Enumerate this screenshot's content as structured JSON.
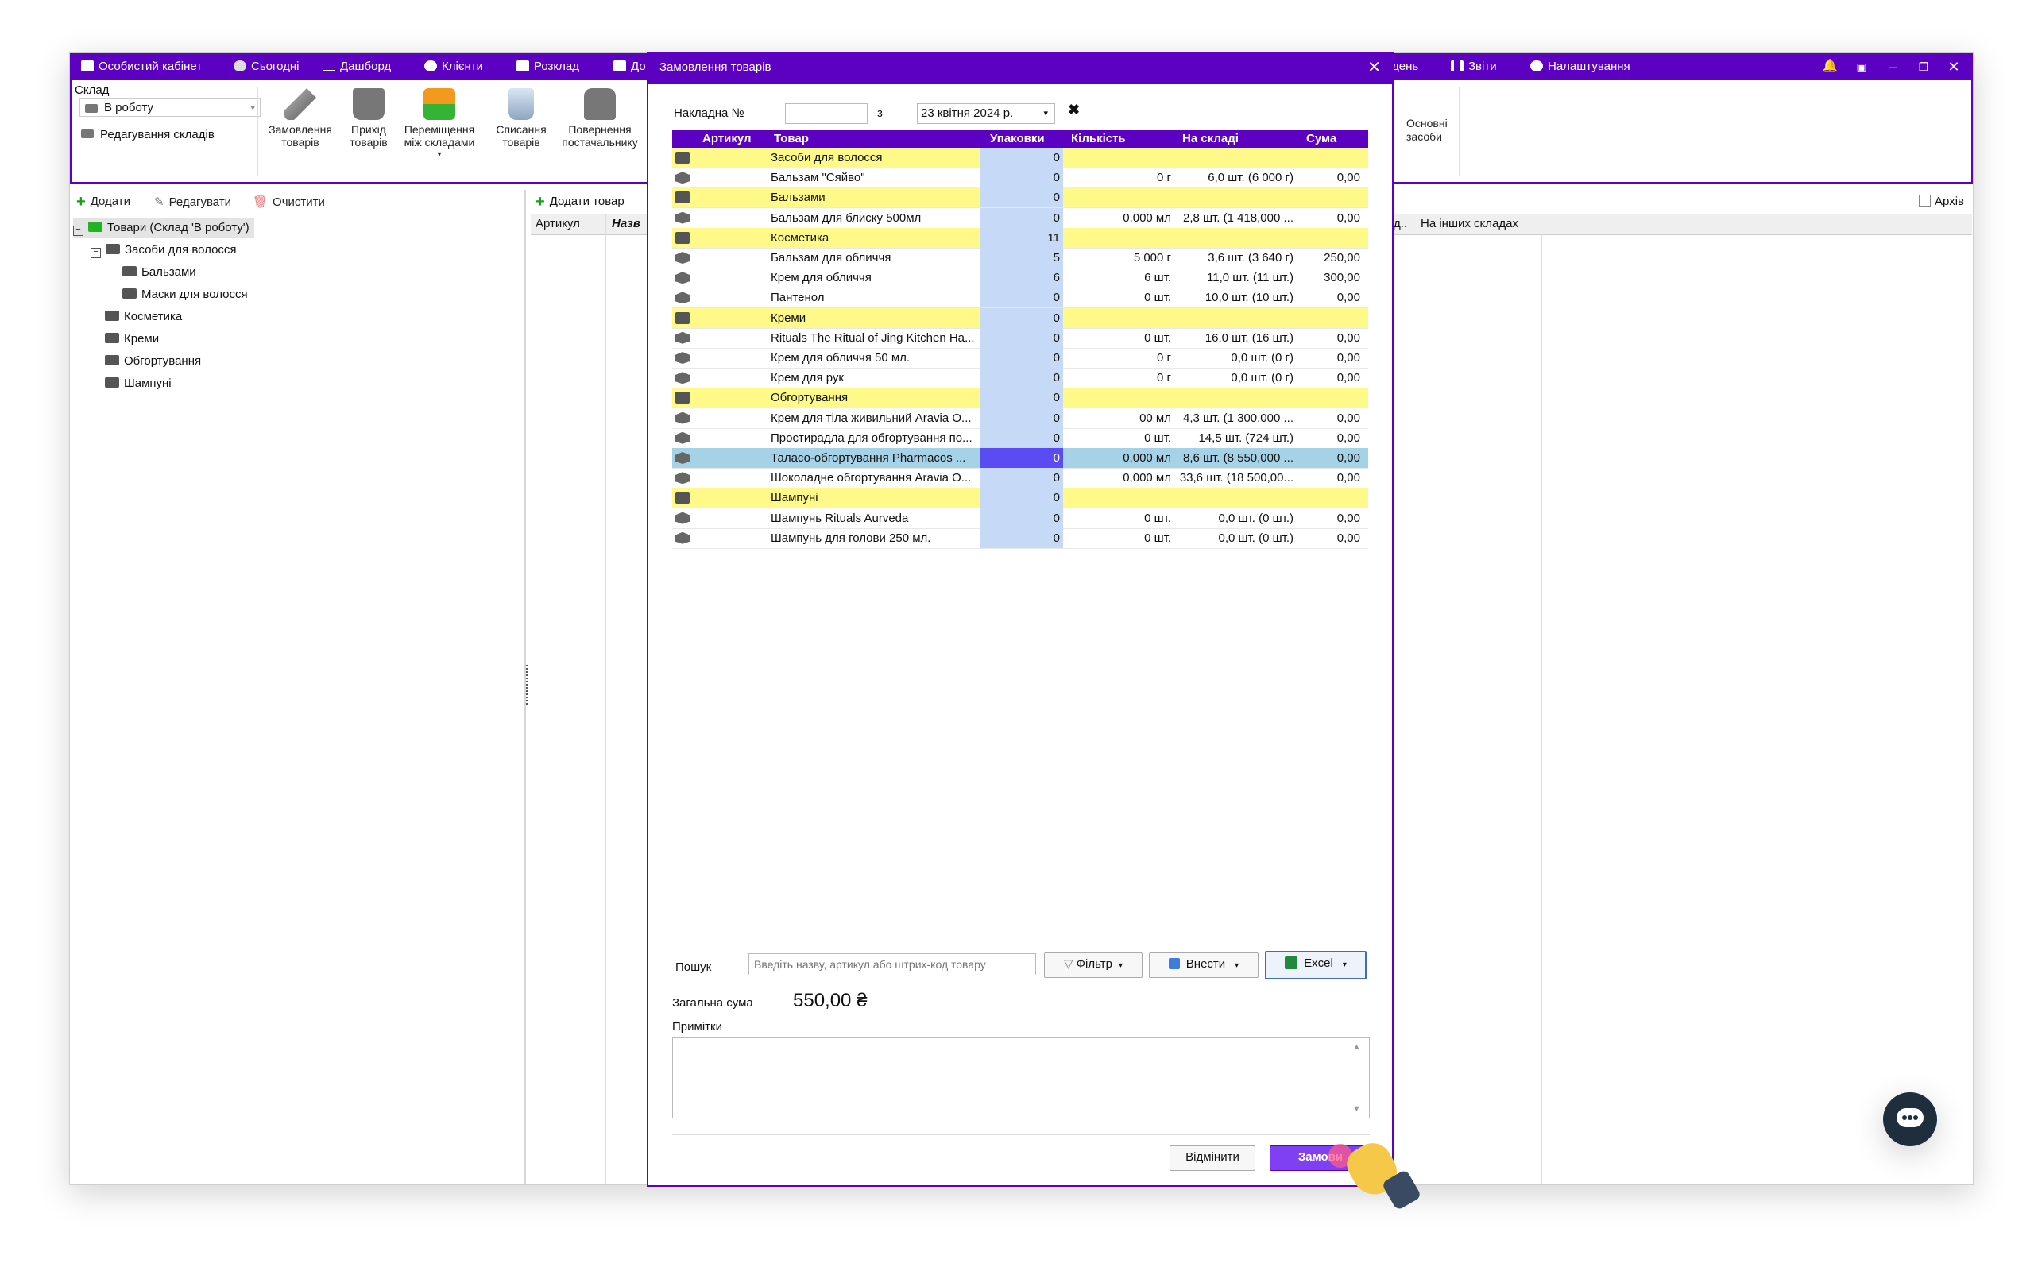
{
  "topbar": {
    "items": [
      "Особистий кабінет",
      "Сьогодні",
      "Дашборд",
      "Клієнти",
      "Розклад",
      "До",
      "день",
      "Звіти",
      "Налаштування"
    ]
  },
  "ribbon": {
    "warehouse_label": "Склад",
    "warehouse_value": "В роботу",
    "edit_warehouses": "Редагування складів",
    "buttons": [
      {
        "label1": "Замовлення",
        "label2": "товарів"
      },
      {
        "label1": "Прихід",
        "label2": "товарів"
      },
      {
        "label1": "Переміщення",
        "label2": "між складами"
      },
      {
        "label1": "Списання",
        "label2": "товарів"
      },
      {
        "label1": "Повернення",
        "label2": "постачальнику"
      }
    ],
    "assets_1": "Основні",
    "assets_2": "засоби"
  },
  "left_toolbar": {
    "add": "Додати",
    "edit": "Редагувати",
    "clear": "Очистити"
  },
  "tree": {
    "root": "Товари (Склад 'В роботу')",
    "items": [
      "Засоби для волосся",
      "Бальзами",
      "Маски для волосся",
      "Косметика",
      "Креми",
      "Обгортування",
      "Шампуні"
    ]
  },
  "middle": {
    "add_product": "Додати товар",
    "col_article": "Артикул",
    "col_name": "Назв"
  },
  "right": {
    "archive": "Архів",
    "col_other": "На інших складах",
    "col_partial": "д.."
  },
  "dialog": {
    "title": "Замовлення товарів",
    "invoice_label": "Накладна  №",
    "from_label": "з",
    "date_value": "23 квітня 2024 р.",
    "columns": [
      "Артикул",
      "Товар",
      "Упаковки",
      "Кількість",
      "На складі",
      "Сума"
    ],
    "rows": [
      {
        "type": "folder",
        "name": "Засоби для волосся",
        "packs": "0",
        "qty": "",
        "stock": "",
        "sum": ""
      },
      {
        "type": "item",
        "name": "Бальзам \"Сяйво\"",
        "packs": "0",
        "qty": "0 г",
        "stock": "6,0 шт. (6 000 г)",
        "sum": "0,00"
      },
      {
        "type": "folder",
        "name": "Бальзами",
        "packs": "0",
        "qty": "",
        "stock": "",
        "sum": ""
      },
      {
        "type": "item",
        "name": "Бальзам для блиску 500мл",
        "packs": "0",
        "qty": "0,000 мл",
        "stock": "2,8 шт. (1 418,000 ...",
        "sum": "0,00"
      },
      {
        "type": "folder",
        "name": "Косметика",
        "packs": "11",
        "qty": "",
        "stock": "",
        "sum": ""
      },
      {
        "type": "item",
        "name": "Бальзам для обличчя",
        "packs": "5",
        "qty": "5 000 г",
        "stock": "3,6 шт. (3 640 г)",
        "sum": "250,00"
      },
      {
        "type": "item",
        "name": "Крем для обличчя",
        "packs": "6",
        "qty": "6 шт.",
        "stock": "11,0 шт. (11 шт.)",
        "sum": "300,00"
      },
      {
        "type": "item",
        "name": "Пантенол",
        "packs": "0",
        "qty": "0 шт.",
        "stock": "10,0 шт. (10 шт.)",
        "sum": "0,00"
      },
      {
        "type": "folder",
        "name": "Креми",
        "packs": "0",
        "qty": "",
        "stock": "",
        "sum": ""
      },
      {
        "type": "item",
        "name": "Rituals The Ritual of Jing Kitchen Ha...",
        "packs": "0",
        "qty": "0 шт.",
        "stock": "16,0 шт. (16 шт.)",
        "sum": "0,00"
      },
      {
        "type": "item",
        "name": "Крем для обличчя 50 мл.",
        "packs": "0",
        "qty": "0 г",
        "stock": "0,0 шт. (0 г)",
        "sum": "0,00"
      },
      {
        "type": "item",
        "name": "Крем для рук",
        "packs": "0",
        "qty": "0 г",
        "stock": "0,0 шт. (0 г)",
        "sum": "0,00"
      },
      {
        "type": "folder",
        "name": "Обгортування",
        "packs": "0",
        "qty": "",
        "stock": "",
        "sum": ""
      },
      {
        "type": "item",
        "name": "Крем для тіла живильний Aravia O...",
        "packs": "0",
        "qty": "00 мл",
        "stock": "4,3 шт. (1 300,000 ...",
        "sum": "0,00"
      },
      {
        "type": "item",
        "name": "Простирадла для обгортування по...",
        "packs": "0",
        "qty": "0 шт.",
        "stock": "14,5 шт. (724 шт.)",
        "sum": "0,00"
      },
      {
        "type": "selected",
        "name": "Таласо-обгортування Pharmacos ...",
        "packs": "0",
        "qty": "0,000 мл",
        "stock": "8,6 шт. (8 550,000 ...",
        "sum": "0,00"
      },
      {
        "type": "item",
        "name": "Шоколадне обгортування Aravia O...",
        "packs": "0",
        "qty": "0,000 мл",
        "stock": "33,6 шт. (18 500,00...",
        "sum": "0,00"
      },
      {
        "type": "folder",
        "name": "Шампуні",
        "packs": "0",
        "qty": "",
        "stock": "",
        "sum": ""
      },
      {
        "type": "item",
        "name": "Шампунь Rituals Aurveda",
        "packs": "0",
        "qty": "0 шт.",
        "stock": "0,0 шт. (0 шт.)",
        "sum": "0,00"
      },
      {
        "type": "item",
        "name": "Шампунь для голови 250 мл.",
        "packs": "0",
        "qty": "0 шт.",
        "stock": "0,0 шт. (0 шт.)",
        "sum": "0,00"
      }
    ],
    "search_label": "Пошук",
    "search_placeholder": "Введіть назву, артикул або штрих-код товару",
    "filter_btn": "Фільтр",
    "import_btn": "Внести",
    "excel_btn": "Excel",
    "total_label": "Загальна сума",
    "total_value": "550,00 ₴",
    "notes_label": "Примітки",
    "cancel_btn": "Відмінити",
    "order_btn": "Замови"
  },
  "colors": {
    "accent": "#5c00c2",
    "folder_row": "#fff98a",
    "qty_cell": "#c6d9f7",
    "selected_row": "#a6d2e8"
  }
}
